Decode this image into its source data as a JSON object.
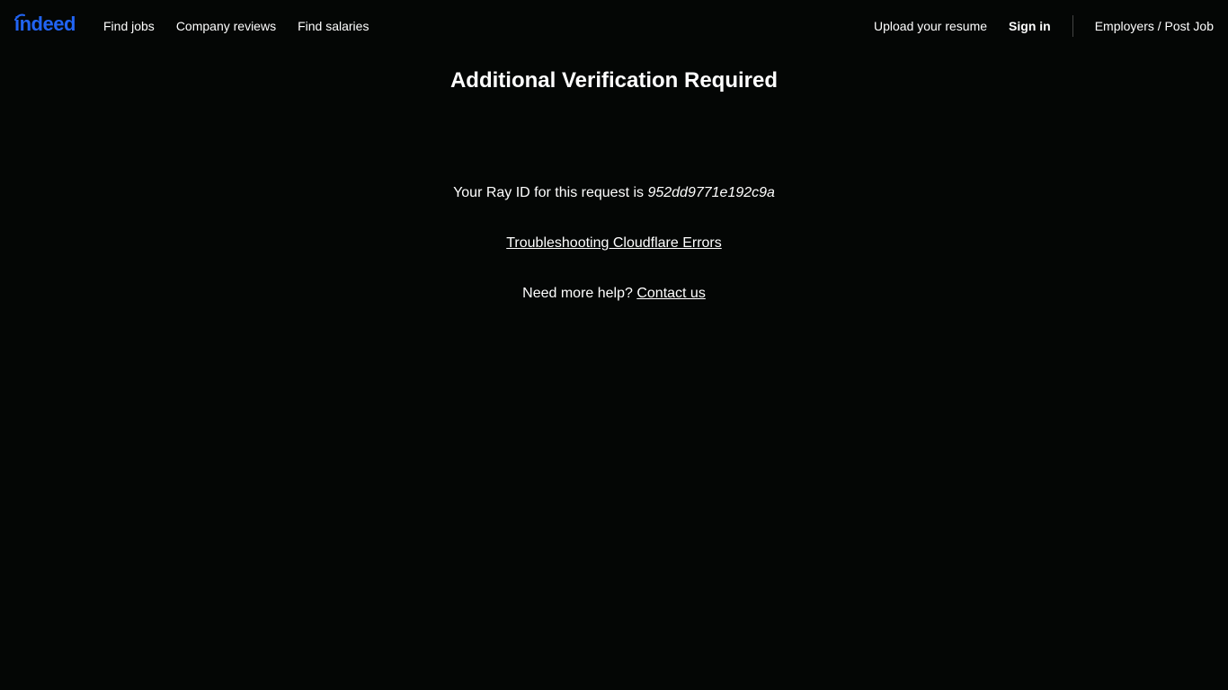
{
  "brand": {
    "logo_text": "indeed",
    "logo_color": "#2164f3"
  },
  "nav": {
    "find_jobs": "Find jobs",
    "company_reviews": "Company reviews",
    "find_salaries": "Find salaries",
    "upload_resume": "Upload your resume",
    "sign_in": "Sign in",
    "employers": "Employers / Post Job"
  },
  "main": {
    "title": "Additional Verification Required",
    "ray_prefix": "Your Ray ID for this request is ",
    "ray_id": "952dd9771e192c9a",
    "troubleshooting_link": "Troubleshooting Cloudflare Errors",
    "help_prefix": "Need more help? ",
    "contact_link": "Contact us"
  },
  "colors": {
    "background": "#040605",
    "text": "#ffffff"
  }
}
